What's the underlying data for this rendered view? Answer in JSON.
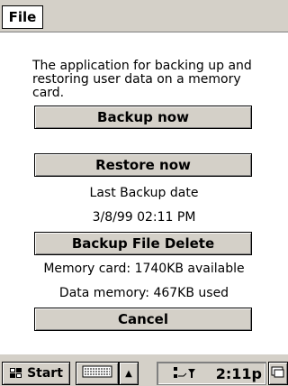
{
  "menubar": {
    "file_label": "File"
  },
  "main": {
    "description": "The application for backing up and restoring user data on a memory card.",
    "backup_button": "Backup now",
    "restore_button": "Restore now",
    "last_backup_label": "Last Backup date",
    "last_backup_value": "3/8/99 02:11 PM",
    "delete_button": "Backup File Delete",
    "memory_card_status": "Memory card: 1740KB available",
    "data_memory_status": "Data memory: 467KB used",
    "cancel_button": "Cancel"
  },
  "taskbar": {
    "start_label": "Start",
    "start_icon": "windows-flag-icon",
    "keyboard_icon": "keyboard-icon",
    "arrow_icon": "up-arrow-icon",
    "tray_icon": "connection-icon",
    "clock": "2:11p",
    "desktop_icon": "desktop-icon"
  },
  "colors": {
    "chrome": "#d4d0c8",
    "background": "#ffffff"
  }
}
